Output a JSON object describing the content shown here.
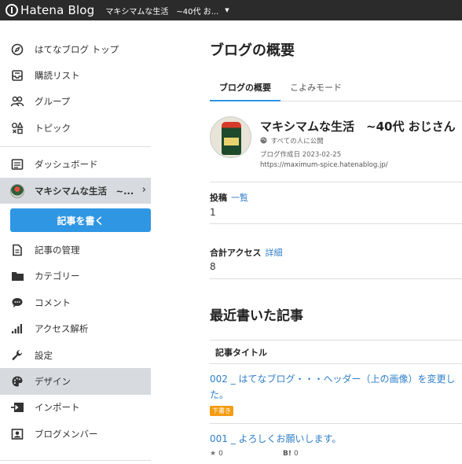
{
  "header": {
    "logo_text": "Hatena Blog",
    "blog_switch": "マキシマムな生活　~40代 お...",
    "caret": "▼"
  },
  "sidebar": {
    "top_items": [
      {
        "label": "はてなブログ トップ",
        "icon": "compass-icon"
      },
      {
        "label": "購読リスト",
        "icon": "inbox-icon"
      },
      {
        "label": "グループ",
        "icon": "group-icon"
      },
      {
        "label": "トピック",
        "icon": "topic-icon"
      }
    ],
    "dashboard": "ダッシュボード",
    "blog_item": "マキシマムな生活　~...",
    "write_button": "記事を書く",
    "items": [
      {
        "label": "記事の管理",
        "icon": "document-icon"
      },
      {
        "label": "カテゴリー",
        "icon": "folder-icon"
      },
      {
        "label": "コメント",
        "icon": "comment-icon"
      },
      {
        "label": "アクセス解析",
        "icon": "bar-chart-icon"
      },
      {
        "label": "設定",
        "icon": "wrench-icon"
      },
      {
        "label": "デザイン",
        "icon": "palette-icon"
      },
      {
        "label": "インポート",
        "icon": "import-icon"
      },
      {
        "label": "ブログメンバー",
        "icon": "member-icon"
      }
    ],
    "active_item": "デザイン"
  },
  "main": {
    "title": "ブログの概要",
    "tabs": [
      "ブログの概要",
      "こよみモード"
    ],
    "blog": {
      "name": "マキシマムな生活　~40代 おじさん",
      "visibility": "すべての人に公開",
      "created": "ブログ作成日 2023-02-25",
      "url": "https://maximum-spice.hatenablog.jp/"
    },
    "posts": {
      "label": "投稿",
      "link": "一覧",
      "value": "1"
    },
    "access": {
      "label": "合計アクセス",
      "link": "詳細",
      "value": "8"
    },
    "recent_title": "最近書いた記事",
    "table_header": "記事タイトル",
    "entries": [
      {
        "title": "002 _ はてなブログ・・・ヘッダー（上の画像）を変更した。",
        "badge": "下書き"
      },
      {
        "title": "001 _ よろしくお願いします。",
        "stars": "0",
        "bookmarks": "0"
      }
    ],
    "bookmark_label": "B!"
  },
  "colors": {
    "accent": "#2f96e4",
    "link": "#2f7fc9",
    "draft_badge": "#f39c12",
    "topbar": "#2b2b2b"
  }
}
